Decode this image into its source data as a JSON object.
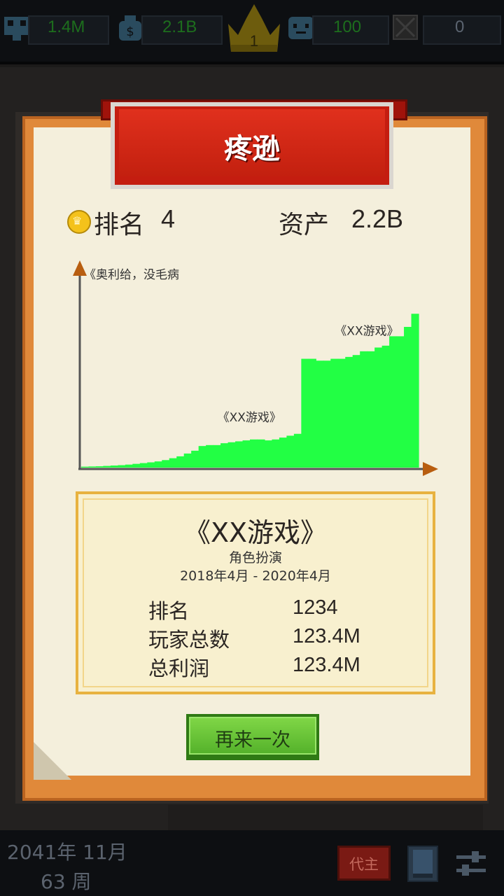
{
  "hud": {
    "money": "1.4M",
    "fans": "2.1B",
    "crown_rank": "1",
    "employees": "100",
    "items": "0"
  },
  "card": {
    "title": "疼逊",
    "rank_label": "排名",
    "rank_value": "4",
    "assets_label": "资产",
    "assets_value": "2.2B"
  },
  "chart_data": {
    "type": "area",
    "title": "",
    "xlabel": "",
    "ylabel": "",
    "color": "#22ff44",
    "x": [
      0,
      1,
      2,
      3,
      4,
      5,
      6,
      7,
      8,
      9,
      10,
      11,
      12,
      13,
      14,
      15,
      16,
      17,
      18,
      19,
      20,
      21,
      22,
      23,
      24,
      25,
      26,
      27,
      28,
      29,
      30,
      31,
      32,
      33,
      34,
      35,
      36,
      37,
      38,
      39,
      40,
      41,
      42,
      43,
      44,
      45
    ],
    "values": [
      0.5,
      0.6,
      0.7,
      0.9,
      1.1,
      1.3,
      1.6,
      2.0,
      2.4,
      2.8,
      3.3,
      4,
      5,
      6,
      7.5,
      9,
      11.5,
      12,
      12,
      13,
      13.5,
      14,
      14.5,
      15,
      15,
      14.5,
      15,
      16,
      17,
      18,
      58,
      58,
      57,
      57,
      58,
      58,
      59,
      60,
      62,
      62,
      64,
      65,
      70,
      70,
      75,
      82
    ],
    "annotations": [
      {
        "text": "《奥利给，没毛病",
        "x": 0
      },
      {
        "text": "《XX游戏》",
        "x": 18
      },
      {
        "text": "《XX游戏》",
        "x": 34
      }
    ]
  },
  "game": {
    "title": "《XX游戏》",
    "genre": "角色扮演",
    "dates": "2018年4月 - 2020年4月",
    "stats": [
      {
        "label": "排名",
        "value": "1234"
      },
      {
        "label": "玩家总数",
        "value": "123.4M"
      },
      {
        "label": "总利润",
        "value": "123.4M"
      }
    ]
  },
  "retry_label": "再来一次",
  "bottom": {
    "date_line1": "2041年 11月",
    "date_line2": "63 周",
    "boss_label": "代主"
  }
}
